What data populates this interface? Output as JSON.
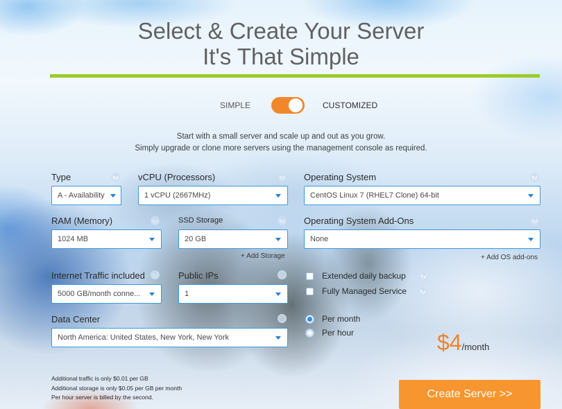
{
  "header": {
    "title_line1": "Select & Create Your Server",
    "title_line2": "It's That Simple"
  },
  "mode_toggle": {
    "left_label": "SIMPLE",
    "right_label": "CUSTOMIZED",
    "selected": "CUSTOMIZED",
    "on": true
  },
  "intro": {
    "line1": "Start with a small server and scale up and out as you grow.",
    "line2": "Simply upgrade or clone more servers using the management console as required."
  },
  "help_icon_glyph": "?",
  "fields": {
    "type": {
      "label": "Type",
      "value": "A - Availability"
    },
    "vcpu": {
      "label": "vCPU (Processors)",
      "value": "1 vCPU (2667MHz)"
    },
    "os": {
      "label": "Operating System",
      "value": "CentOS Linux 7 (RHEL7 Clone) 64-bit"
    },
    "ram": {
      "label": "RAM (Memory)",
      "value": "1024 MB"
    },
    "ssd": {
      "label": "SSD Storage",
      "value": "20 GB",
      "add_link": "+ Add Storage"
    },
    "os_addons": {
      "label": "Operating System Add-Ons",
      "value": "None",
      "add_link": "+ Add OS add-ons"
    },
    "traffic": {
      "label": "Internet Traffic included",
      "value": "5000 GB/month conne..."
    },
    "public_ips": {
      "label": "Public IPs",
      "value": "1"
    },
    "datacenter": {
      "label": "Data Center",
      "value": "North America: United States, New York, New York"
    }
  },
  "options": {
    "extended_backup": {
      "label": "Extended daily backup",
      "checked": false
    },
    "managed_service": {
      "label": "Fully Managed Service",
      "checked": false
    }
  },
  "billing": {
    "per_month": {
      "label": "Per month",
      "selected": true
    },
    "per_hour": {
      "label": "Per hour",
      "selected": false
    }
  },
  "price": {
    "amount": "$4",
    "unit": "/month"
  },
  "notes": [
    "Additional traffic is only $0.01 per GB",
    "Additional storage is only $0.05 per GB per month",
    "Per hour server is billed by the second."
  ],
  "actions": {
    "create_label": "Create Server >>"
  },
  "colors": {
    "accent_orange": "#f7962f",
    "price_orange": "#f2832b",
    "divider_green": "#9ccc2a",
    "select_border_blue": "#3d9ad8"
  }
}
